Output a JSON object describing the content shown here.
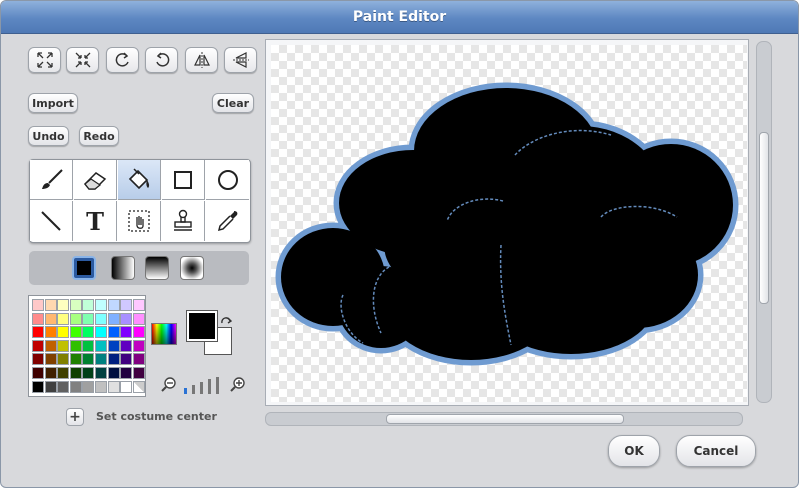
{
  "window": {
    "title": "Paint Editor"
  },
  "toolbar": {
    "grow_icon": "expand-icon",
    "shrink_icon": "shrink-icon",
    "rotate_left_icon": "rotate-left-icon",
    "rotate_right_icon": "rotate-right-icon",
    "flip_horizontal_icon": "flip-horizontal-icon",
    "flip_vertical_icon": "flip-vertical-icon"
  },
  "actions": {
    "import": "Import",
    "clear": "Clear",
    "undo": "Undo",
    "redo": "Redo"
  },
  "tools": {
    "items": [
      "paintbrush",
      "eraser",
      "fill-bucket",
      "rectangle",
      "ellipse",
      "line",
      "text",
      "select",
      "stamp",
      "eyedropper"
    ],
    "text_glyph": "T",
    "active": "fill-bucket"
  },
  "fill_options": [
    "solid",
    "horizontal-gradient",
    "vertical-gradient",
    "radial-gradient"
  ],
  "palette": {
    "rows": [
      [
        "#ffc8c8",
        "#ffd8b0",
        "#ffffc0",
        "#d8ffc0",
        "#c0ffd8",
        "#c0ffff",
        "#c0d8ff",
        "#d0c8ff",
        "#ffc8ff"
      ],
      [
        "#ff8c8c",
        "#ffb870",
        "#ffff80",
        "#a8ff80",
        "#80ffb0",
        "#80ffff",
        "#80b0ff",
        "#a890ff",
        "#ff90ff"
      ],
      [
        "#ff0000",
        "#ff8000",
        "#ffff00",
        "#40ff00",
        "#00ff60",
        "#00ffff",
        "#0060ff",
        "#8000ff",
        "#ff00ff"
      ],
      [
        "#c00000",
        "#c06000",
        "#c0c000",
        "#30c000",
        "#00c040",
        "#00c0c0",
        "#0040c0",
        "#6000c0",
        "#c000c0"
      ],
      [
        "#800000",
        "#804000",
        "#808000",
        "#208000",
        "#008030",
        "#008080",
        "#002080",
        "#400080",
        "#800080"
      ],
      [
        "#400000",
        "#402000",
        "#404000",
        "#104000",
        "#004018",
        "#004040",
        "#001040",
        "#200040",
        "#400040"
      ],
      [
        "#000000",
        "#404040",
        "#606060",
        "#808080",
        "#a0a0a0",
        "#c0c0c0",
        "#e0e0e0",
        "#ffffff",
        "transparent"
      ]
    ],
    "foreground": "#000000",
    "background": "#ffffff",
    "color_picker_icon": "color-spectrum-icon",
    "swap_icon": "swap-colors-icon"
  },
  "brush": {
    "zoom_out_icon": "zoom-out-icon",
    "zoom_in_icon": "zoom-in-icon",
    "selected_size": 1
  },
  "costume_center": {
    "label": "Set costume center",
    "icon": "plus-icon"
  },
  "canvas": {
    "shape_color": "#000000",
    "outline_color": "#6f9bd1"
  },
  "footer": {
    "ok": "OK",
    "cancel": "Cancel"
  }
}
